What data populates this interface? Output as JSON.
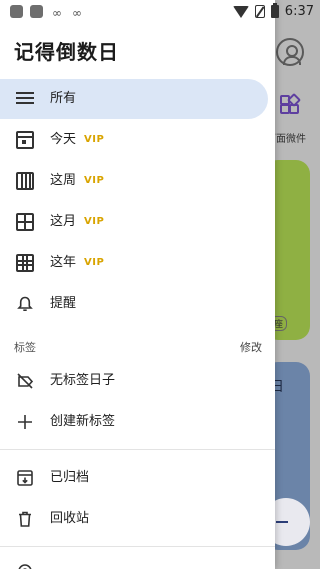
{
  "status_bar": {
    "time": "6:37",
    "loop_icons": [
      "∞",
      "∞"
    ]
  },
  "background": {
    "widget_label": "面面微件",
    "tag_text": "座",
    "card_text": "日"
  },
  "drawer": {
    "title": "记得倒数日",
    "menu": [
      {
        "label": "所有",
        "icon": "list-icon",
        "active": true
      },
      {
        "label": "今天",
        "vip": "VIP",
        "icon": "calendar-day-icon"
      },
      {
        "label": "这周",
        "vip": "VIP",
        "icon": "calendar-week-icon"
      },
      {
        "label": "这月",
        "vip": "VIP",
        "icon": "calendar-month-icon"
      },
      {
        "label": "这年",
        "vip": "VIP",
        "icon": "calendar-year-icon"
      },
      {
        "label": "提醒",
        "icon": "bell-icon"
      }
    ],
    "tags_section": {
      "label": "标签",
      "edit": "修改",
      "items": [
        {
          "label": "无标签日子",
          "icon": "tag-off-icon"
        },
        {
          "label": "创建新标签",
          "icon": "plus-icon"
        }
      ]
    },
    "bottom_items": [
      {
        "label": "已归档",
        "icon": "archive-icon"
      },
      {
        "label": "回收站",
        "icon": "trash-icon"
      }
    ]
  },
  "colors": {
    "active_bg": "#dbe6f6",
    "vip": "#d9a400",
    "card_green": "#8fb043",
    "card_blue": "#6b84a8"
  }
}
